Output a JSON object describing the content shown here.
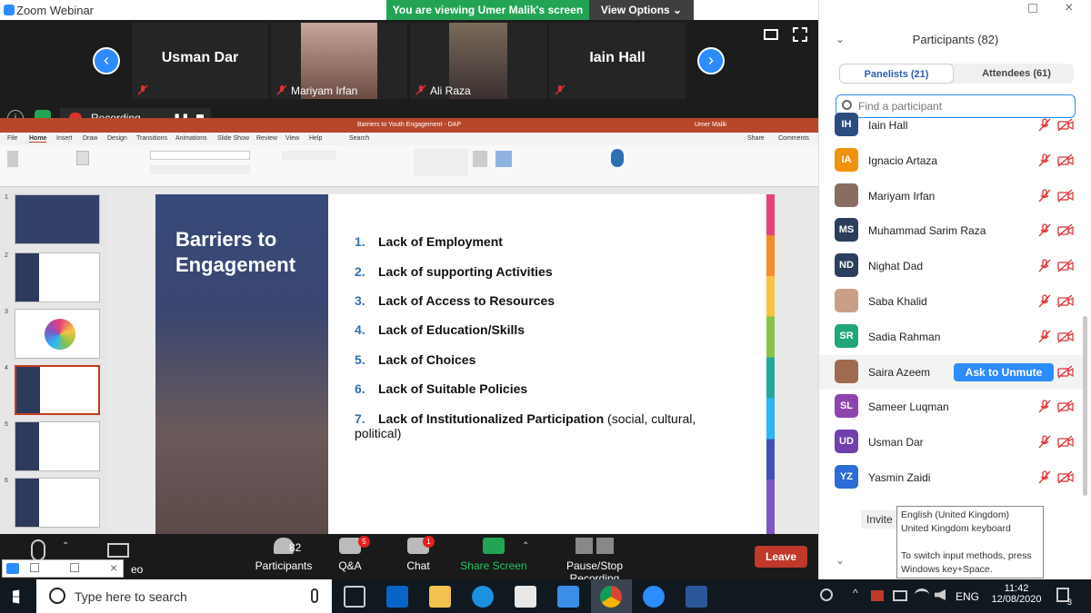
{
  "window": {
    "app_title": "Zoom Webinar"
  },
  "banner": {
    "viewing": "You are viewing Umer Malik's screen",
    "view_options": "View Options ⌄"
  },
  "videos": [
    {
      "name": "Usman Dar",
      "label": ""
    },
    {
      "name": "",
      "label": "Mariyam Irfan"
    },
    {
      "name": "",
      "label": "Ali Raza"
    },
    {
      "name": "Iain Hall",
      "label": ""
    }
  ],
  "recording": {
    "label": "Recording..."
  },
  "ppt": {
    "title": "Barriers to Youth Engagement - DAP",
    "user": "Umer Malik",
    "menu": [
      "File",
      "Home",
      "Insert",
      "Draw",
      "Design",
      "Transitions",
      "Animations",
      "Slide Show",
      "Review",
      "View",
      "Help",
      "Search"
    ],
    "share": "Share",
    "comments": "Comments",
    "thumb_numbers": [
      "1",
      "2",
      "3",
      "4",
      "5",
      "6"
    ],
    "slide_title": "Barriers to Engagement",
    "items": [
      {
        "num": "1.",
        "text": "Lack of Employment",
        "extra": ""
      },
      {
        "num": "2.",
        "text": "Lack of supporting Activities",
        "extra": ""
      },
      {
        "num": "3.",
        "text": "Lack of Access to Resources",
        "extra": ""
      },
      {
        "num": "4.",
        "text": "Lack of Education/Skills",
        "extra": ""
      },
      {
        "num": "5.",
        "text": "Lack of Choices",
        "extra": ""
      },
      {
        "num": "6.",
        "text": "Lack of Suitable Policies",
        "extra": ""
      },
      {
        "num": "7.",
        "text": "Lack of Institutionalized Participation",
        "extra": " (social, cultural, political)"
      }
    ]
  },
  "toolbar": {
    "video_label": "eo",
    "participants_label": "Participants",
    "participants_count": "82",
    "qa_label": "Q&A",
    "qa_badge": "5",
    "chat_label": "Chat",
    "chat_badge": "1",
    "share_label": "Share Screen",
    "record_label": "Pause/Stop Recording",
    "leave_label": "Leave"
  },
  "panel": {
    "title": "Participants (82)",
    "tab_panelists": "Panelists (21)",
    "tab_attendees": "Attendees (61)",
    "search_placeholder": "Find a participant",
    "unmute_label": "Ask to Unmute",
    "invite_label": "Invite",
    "participants": [
      {
        "initials": "IH",
        "name": "Iain Hall",
        "color": "#2b4c7e"
      },
      {
        "initials": "IA",
        "name": "Ignacio Artaza",
        "color": "#f0920a"
      },
      {
        "initials": "",
        "name": "Mariyam Irfan",
        "color": "#8a6d62"
      },
      {
        "initials": "MS",
        "name": "Muhammad Sarim Raza",
        "color": "#2b3e5c"
      },
      {
        "initials": "ND",
        "name": "Nighat Dad",
        "color": "#2b3e5c"
      },
      {
        "initials": "",
        "name": "Saba Khalid",
        "color": "#c9a087"
      },
      {
        "initials": "SR",
        "name": "Sadia Rahman",
        "color": "#1fa67a"
      },
      {
        "initials": "",
        "name": "Saira Azeem",
        "color": "#a06a50"
      },
      {
        "initials": "SL",
        "name": "Sameer Luqman",
        "color": "#8e44ad"
      },
      {
        "initials": "UD",
        "name": "Usman Dar",
        "color": "#6f3fb0"
      },
      {
        "initials": "YZ",
        "name": "Yasmin Zaidi",
        "color": "#2d6bd6"
      }
    ]
  },
  "tooltip": {
    "line1": "English (United Kingdom)",
    "line2": "United Kingdom keyboard",
    "line3": "To switch input methods, press Windows key+Space."
  },
  "taskbar": {
    "search_placeholder": "Type here to search",
    "lang": "ENG",
    "time": "11:42",
    "date": "12/08/2020",
    "notif_count": "3"
  }
}
